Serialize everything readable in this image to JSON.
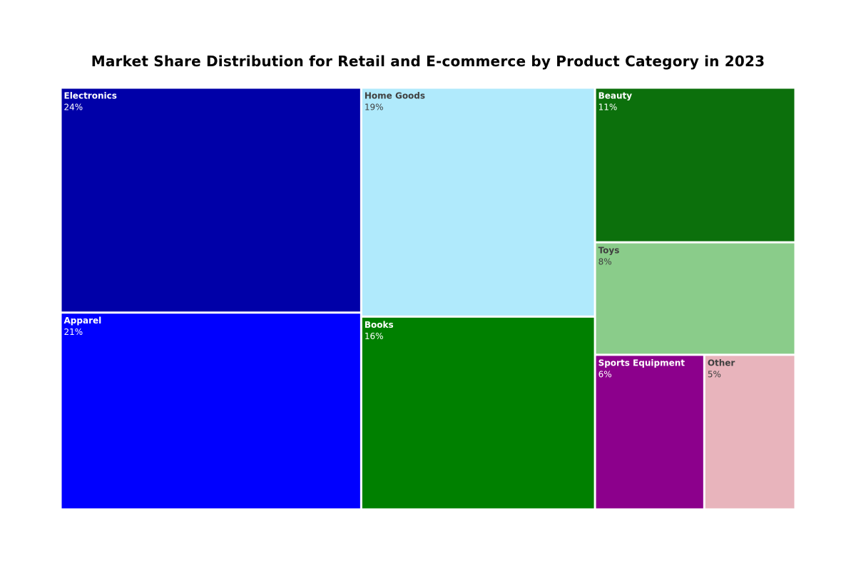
{
  "chart_data": {
    "type": "treemap",
    "title": "Market Share Distribution for Retail and E-commerce by Product Category in 2023",
    "categories": [
      "Electronics",
      "Apparel",
      "Home Goods",
      "Books",
      "Beauty",
      "Toys",
      "Sports Equipment",
      "Other"
    ],
    "values": [
      24,
      21,
      19,
      16,
      11,
      8,
      6,
      5
    ],
    "value_labels": [
      "24%",
      "21%",
      "19%",
      "16%",
      "11%",
      "8%",
      "6%",
      "5%"
    ],
    "colors": [
      "#0000a8",
      "#0000ff",
      "#b0eafc",
      "#008000",
      "#0c700c",
      "#8acc8a",
      "#8c008c",
      "#e8b4bc"
    ],
    "label_colors": [
      "#ffffff",
      "#ffffff",
      "#404040",
      "#ffffff",
      "#ffffff",
      "#404040",
      "#ffffff",
      "#404040"
    ],
    "grid": false,
    "legend": "none"
  }
}
